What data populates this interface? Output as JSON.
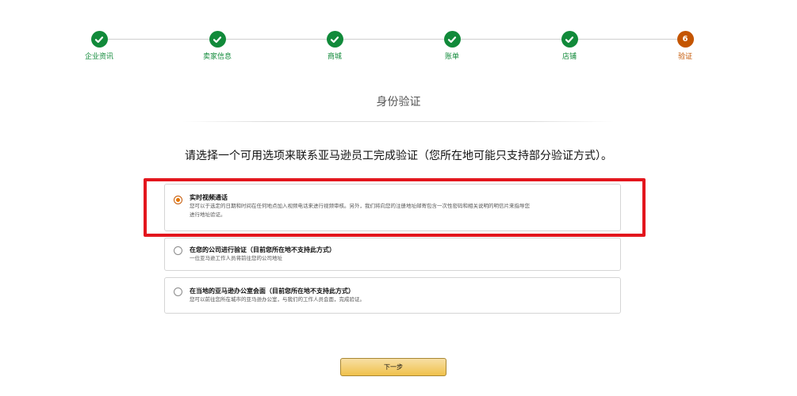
{
  "stepper": {
    "steps": [
      {
        "label": "企业资讯",
        "state": "done"
      },
      {
        "label": "卖家信息",
        "state": "done"
      },
      {
        "label": "商城",
        "state": "done"
      },
      {
        "label": "账单",
        "state": "done"
      },
      {
        "label": "店铺",
        "state": "done"
      },
      {
        "label": "验证",
        "state": "current",
        "number": "6"
      }
    ],
    "done_color": "#118a3a",
    "current_color": "#c45500"
  },
  "header": {
    "title": "身份验证",
    "instruction": "请选择一个可用选项来联系亚马逊员工完成验证（您所在地可能只支持部分验证方式）。"
  },
  "options": [
    {
      "title": "实时视频通话",
      "description_line1": "您可以于选定的日期和时间在任何地点加入视频电话来进行视频审核。另外，我们将向您的注册地址邮寄包含一次性密码和相关说明的明信片来指导您",
      "description_line2": "进行地址验证。",
      "selected": true
    },
    {
      "title": "在您的公司进行验证（目前您所在地不支持此方式）",
      "description_line1": "一位亚马逊工作人员将前往您的公司地址",
      "selected": false
    },
    {
      "title": "在当地的亚马逊办公室会面（目前您所在地不支持此方式）",
      "description_line1": "您可以前往您所在城市的亚马逊办公室，与我们的工作人员会面，完成验证。",
      "selected": false
    }
  ],
  "actions": {
    "next_label": "下一步"
  },
  "colors": {
    "highlight": "#e3161d",
    "button": "#f0c14b"
  }
}
